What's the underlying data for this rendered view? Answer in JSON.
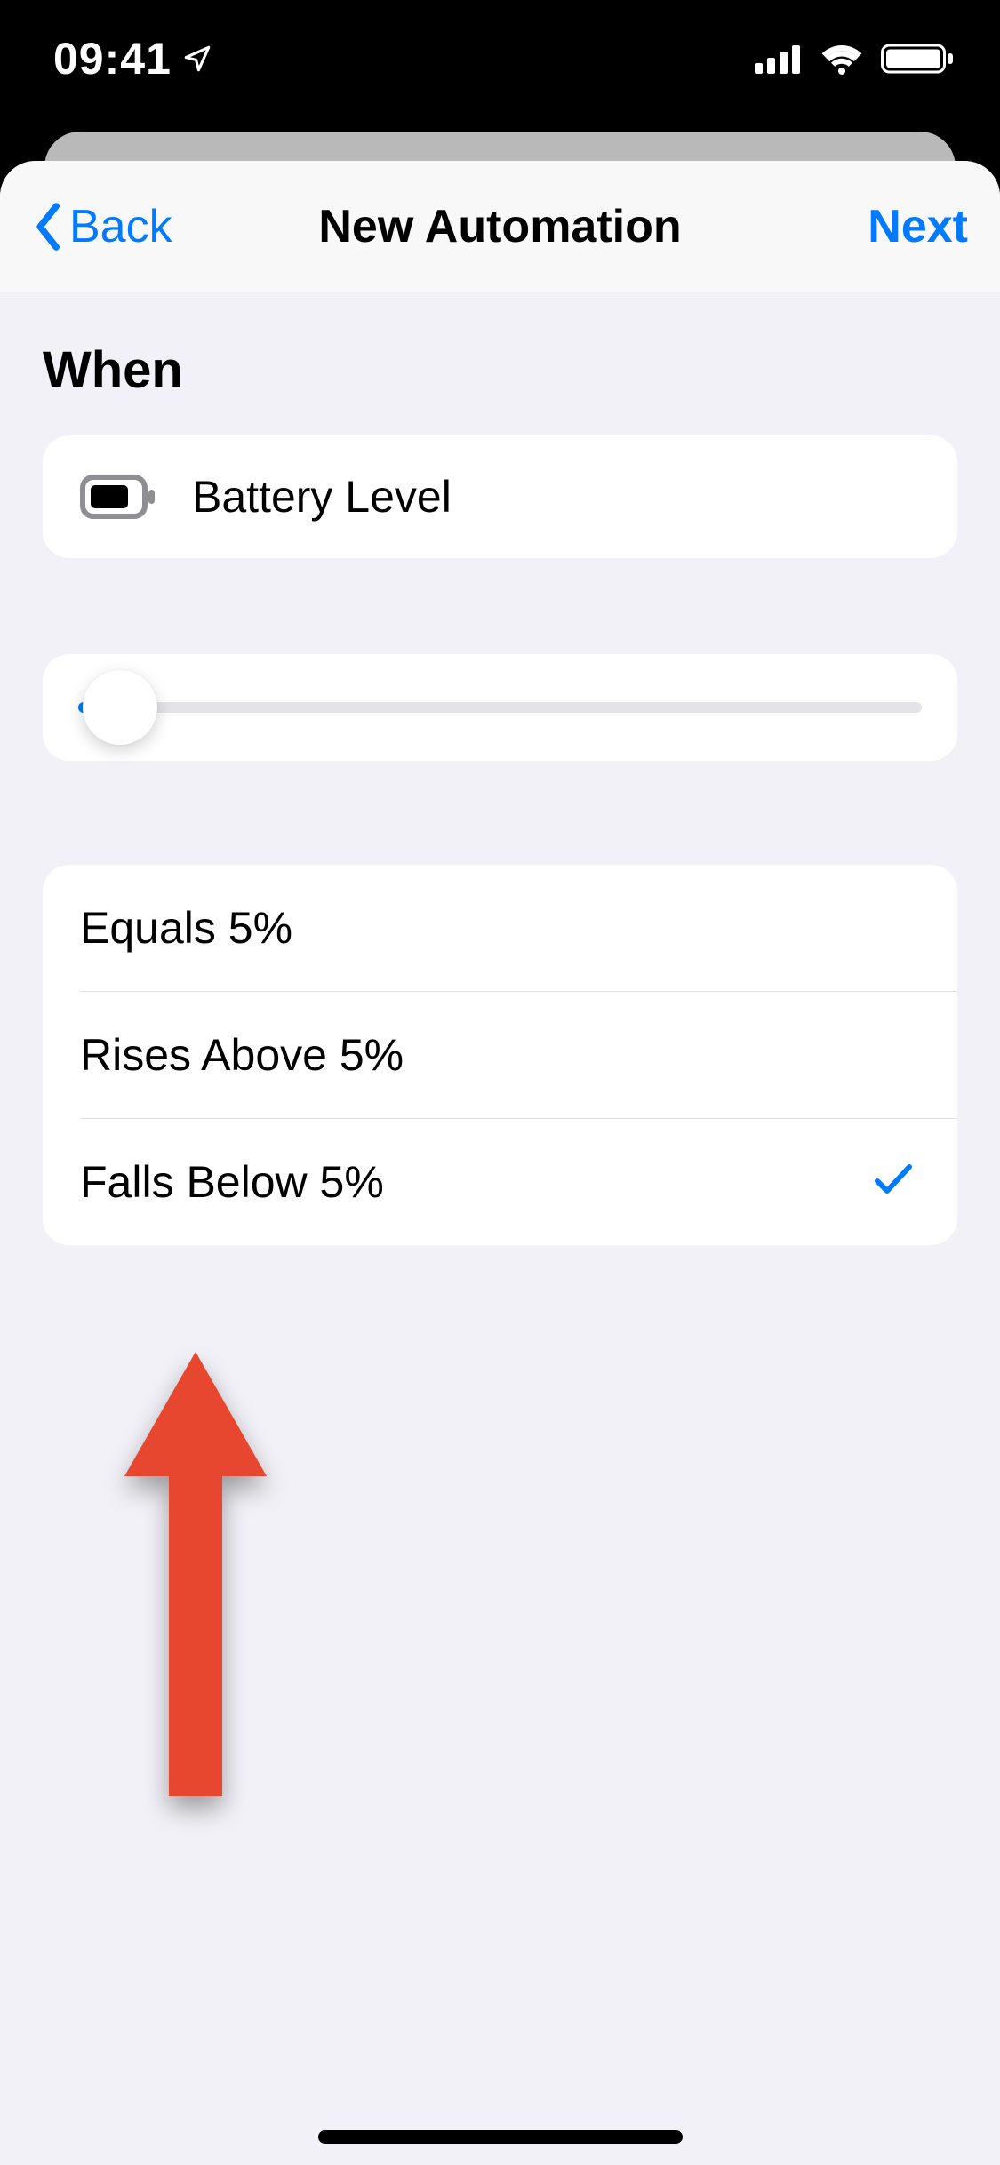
{
  "status": {
    "time": "09:41"
  },
  "nav": {
    "back": "Back",
    "title": "New Automation",
    "next": "Next"
  },
  "section": {
    "when": "When"
  },
  "trigger": {
    "label": "Battery Level"
  },
  "slider": {
    "percent": 5
  },
  "options": [
    {
      "label": "Equals 5%",
      "selected": false
    },
    {
      "label": "Rises Above 5%",
      "selected": false
    },
    {
      "label": "Falls Below 5%",
      "selected": true
    }
  ],
  "colors": {
    "accent": "#007aff",
    "annotation": "#e8472f"
  }
}
